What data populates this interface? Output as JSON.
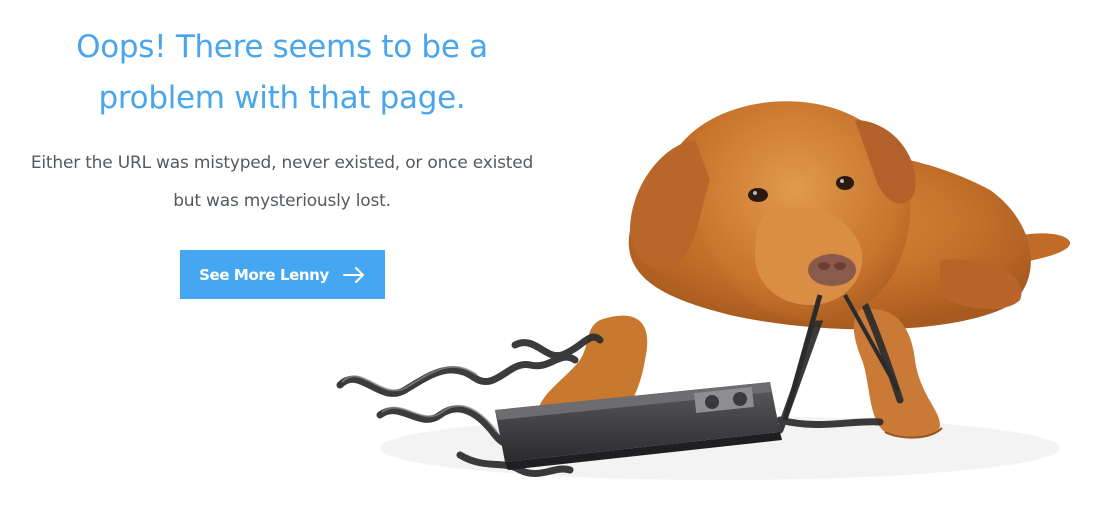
{
  "error_page": {
    "headline": "Oops! There seems to be a problem with that page.",
    "message": "Either the URL was mistyped, never existed, or once existed but was mysteriously lost.",
    "cta_label": "See More Lenny",
    "cta_icon": "arrow-right-icon"
  },
  "colors": {
    "accent": "#4aa6ec",
    "button": "#45a7f2",
    "body_text": "#555a5e",
    "background": "#ffffff"
  },
  "illustration": {
    "subject": "dog chewing on video cassette tape",
    "icon": "dog-illustration"
  }
}
